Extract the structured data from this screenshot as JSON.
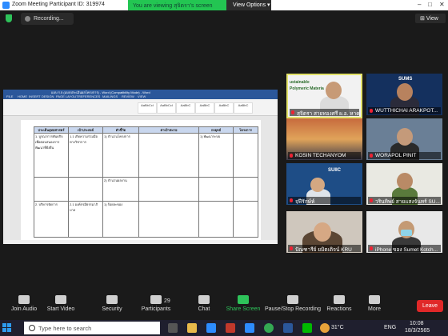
{
  "window": {
    "title": "Zoom Meeting Participant ID: 319974"
  },
  "banner": {
    "viewing": "You are viewing สุจิตรา's screen",
    "options": "View Options ▾"
  },
  "topbar": {
    "recording": "Recording...",
    "view": "⊞ View"
  },
  "shared_doc": {
    "title": "แบบ ร.5 (แบบประเมินผลโครงการ) - Word (Compatibility Mode) - Word",
    "tabs": [
      "FILE",
      "HOME",
      "INSERT",
      "DESIGN",
      "PAGE LAYOUT",
      "REFERENCES",
      "MAILINGS",
      "REVIEW",
      "VIEW"
    ],
    "styles": [
      "AaBbCcI",
      "AaBbCcI",
      "AaBbC",
      "AaBbC",
      "AaBbC",
      "AaBbC"
    ],
    "headers": [
      "ประเด็นยุทธศาสตร์",
      "เป้าประสงค์",
      "ตัวชี้วัด",
      "ค่าเป้าหมาย",
      "กลยุทธ์",
      "โครงการ"
    ],
    "rows": [
      [
        "1. บูรณาการพันธกิจ เพื่อตอบสนองการพัฒนาที่ยั่งยืน",
        "1.1 เกิดความร่วมมือทางวิชาการ",
        "1) จำนวนโครงการ",
        "",
        "1) พัฒนาระบบ",
        ""
      ],
      [
        "",
        "",
        "2) จำนวนผลงาน",
        "",
        "",
        ""
      ],
      [
        "2. บริหารจัดการ",
        "2.1 องค์กรมีธรรมาภิบาล",
        "1) ร้อยละของ",
        "",
        "",
        ""
      ]
    ]
  },
  "participants": [
    {
      "name": "สุจิตรา สายทองศรี ผ.อ. หาดฯ",
      "active": true
    },
    {
      "name": "WUTTHICHAI ARAKPOT...",
      "active": false
    },
    {
      "name": "KOSIN TECHANYOM",
      "active": false
    },
    {
      "name": "WORAPOL PINIT",
      "active": false
    },
    {
      "name": "จุฬีรักษ์ห์",
      "active": false
    },
    {
      "name": "วรินทิพย์ สายแสงจันทร์ SU...",
      "active": false
    },
    {
      "name": "ปัณฑารีย์ ยมิตเติจน์ KRU",
      "active": false
    },
    {
      "name": "iPhone ของ Sumet Kotch...",
      "active": false
    }
  ],
  "tile_labels": {
    "sustainable": "ustainable",
    "polymeric": "Polymeric Materia",
    "sums": "SUMS",
    "suiic": "SUIIC"
  },
  "toolbar": {
    "join_audio": "Join Audio",
    "start_video": "Start Video",
    "security": "Security",
    "participants": "Participants",
    "participants_count": "29",
    "chat": "Chat",
    "share_screen": "Share Screen",
    "record": "Pause/Stop Recording",
    "reactions": "Reactions",
    "more": "More",
    "leave": "Leave"
  },
  "taskbar": {
    "search_placeholder": "Type here to search",
    "temperature": "31°C",
    "language": "ENG",
    "time": "10:08",
    "date": "18/3/2565"
  },
  "colors": {
    "accent": "#2ec35a",
    "leave": "#e02828",
    "zoom_blue": "#2d8cff"
  }
}
